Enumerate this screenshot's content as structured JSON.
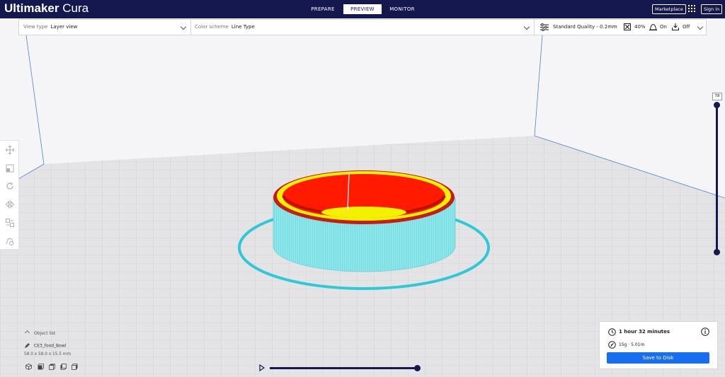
{
  "header": {
    "app_name_bold": "Ultimaker",
    "app_name_light": "Cura",
    "stages": [
      {
        "label": "PREPARE",
        "active": false
      },
      {
        "label": "PREVIEW",
        "active": true
      },
      {
        "label": "MONITOR",
        "active": false
      }
    ],
    "marketplace_label": "Marketplace",
    "signin_label": "Sign in"
  },
  "toolbar": {
    "view_type_label": "View type",
    "view_type_value": "Layer view",
    "color_scheme_label": "Color scheme",
    "color_scheme_value": "Line Type",
    "quality": "Standard Quality - 0.2mm",
    "infill": "40%",
    "support": "On",
    "adhesion": "Off"
  },
  "left_tools": [
    "move-icon",
    "scale-icon",
    "rotate-icon",
    "mirror-icon",
    "per-model-settings-icon",
    "support-blocker-icon"
  ],
  "layer_slider": {
    "current_layer": "78"
  },
  "objects": {
    "header": "Object list",
    "object_name": "CE3_food_Bowl",
    "dimensions": "58.0 x 58.0 x 15.5 mm"
  },
  "view_buttons": [
    "3d-view-icon",
    "front-view-icon",
    "top-view-icon",
    "left-view-icon",
    "right-view-icon"
  ],
  "print_info": {
    "time": "1 hour 32 minutes",
    "material": "15g · 5.01m",
    "save_label": "Save to Disk"
  },
  "colors": {
    "header_bg": "#15184f",
    "accent_blue": "#196ef0",
    "wall_outer": "#6fe3e9",
    "wall_inner": "#ff1a00",
    "top_skin": "#f2f200",
    "skirt": "#2ec8d6"
  }
}
